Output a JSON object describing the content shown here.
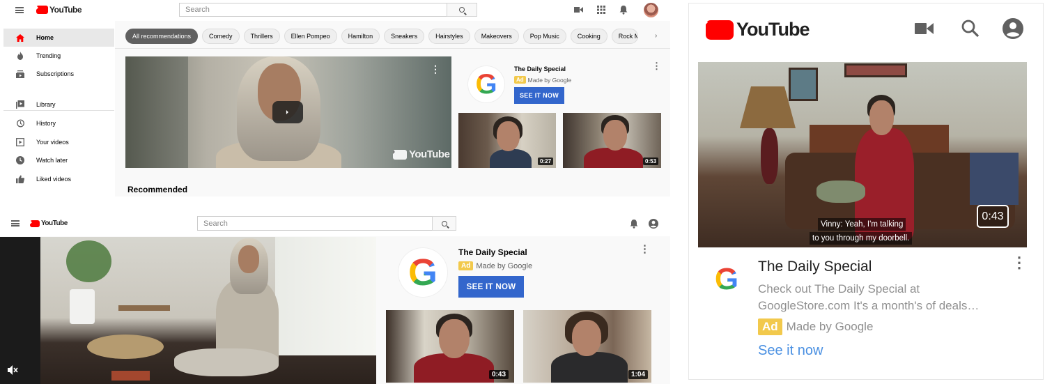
{
  "colors": {
    "brand_red": "#ff0000",
    "cta_blue": "#3366cc",
    "ad_yellow": "#f2c94c",
    "link_blue": "#4a90e2"
  },
  "desktop_home": {
    "logo_text": "YouTube",
    "search_placeholder": "Search",
    "icons": [
      "menu-icon",
      "video-camera-icon",
      "apps-grid-icon",
      "bell-icon",
      "avatar"
    ],
    "sidebar": [
      {
        "label": "Home",
        "icon": "home-icon",
        "active": true
      },
      {
        "label": "Trending",
        "icon": "flame-icon"
      },
      {
        "label": "Subscriptions",
        "icon": "subscriptions-icon"
      },
      {
        "label": "Library",
        "icon": "library-icon"
      },
      {
        "label": "History",
        "icon": "history-icon"
      },
      {
        "label": "Your videos",
        "icon": "your-videos-icon"
      },
      {
        "label": "Watch later",
        "icon": "clock-icon"
      },
      {
        "label": "Liked videos",
        "icon": "thumbs-up-icon"
      }
    ],
    "chips": [
      "All recommendations",
      "Comedy",
      "Thrillers",
      "Ellen Pompeo",
      "Hamilton",
      "Sneakers",
      "Hairstyles",
      "Makeovers",
      "Pop Music",
      "Cooking",
      "Rock M"
    ],
    "watermark": "YouTube",
    "ad": {
      "title": "The Daily Special",
      "badge": "Ad",
      "by": "Made by Google",
      "cta": "SEE IT NOW"
    },
    "thumbs": [
      {
        "duration": "0:27"
      },
      {
        "duration": "0:53"
      }
    ],
    "section_title": "Recommended"
  },
  "watch_page": {
    "logo_text": "YouTube",
    "search_placeholder": "Search",
    "ad": {
      "title": "The Daily Special",
      "badge": "Ad",
      "by": "Made by Google",
      "cta": "SEE IT NOW"
    },
    "thumbs": [
      {
        "duration": "0:43"
      },
      {
        "duration": "1:04"
      }
    ]
  },
  "mobile": {
    "logo_text": "YouTube",
    "caption_line1": "Vinny: Yeah, I'm talking",
    "caption_line2": "to you through my doorbell.",
    "duration": "0:43",
    "ad": {
      "title": "The Daily Special",
      "description": "Check out The Daily Special at GoogleStore.com It's a month's of deals…",
      "badge": "Ad",
      "by": "Made by Google",
      "link": "See it now"
    }
  }
}
